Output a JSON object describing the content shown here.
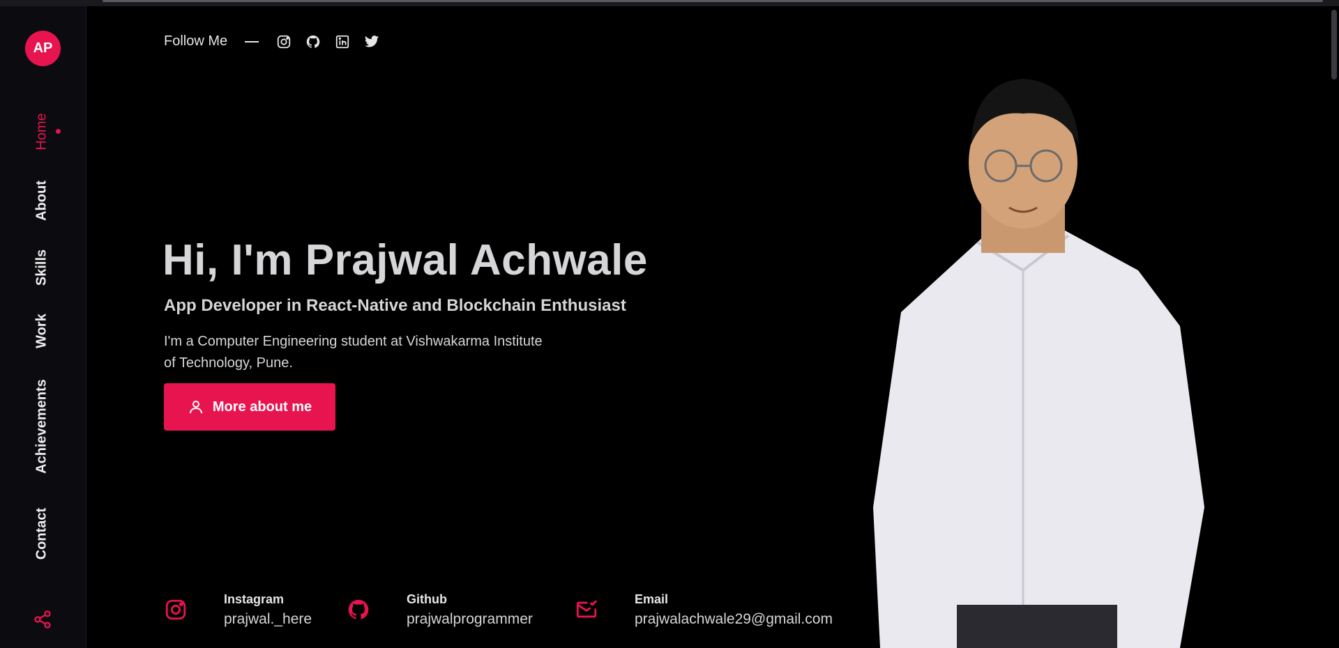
{
  "logo": {
    "initials": "AP"
  },
  "nav": {
    "items": [
      {
        "label": "Home",
        "active": true
      },
      {
        "label": "About"
      },
      {
        "label": "Skills"
      },
      {
        "label": "Work"
      },
      {
        "label": "Achievements"
      },
      {
        "label": "Contact"
      }
    ],
    "share_icon": "share-icon"
  },
  "follow": {
    "label": "Follow Me",
    "icons": [
      "instagram-icon",
      "github-icon",
      "linkedin-icon",
      "twitter-icon"
    ]
  },
  "hero": {
    "title": "Hi, I'm Prajwal Achwale",
    "subtitle": "App Developer in React-Native and Blockchain Enthusiast",
    "description": "I'm a Computer Engineering student at Vishwakarma Institute of Technology, Pune.",
    "button_label": "More about me"
  },
  "contacts": [
    {
      "icon": "instagram-icon",
      "label": "Instagram",
      "value": "prajwal._here"
    },
    {
      "icon": "github-icon",
      "label": "Github",
      "value": "prajwalprogrammer"
    },
    {
      "icon": "email-icon",
      "label": "Email",
      "value": "prajwalachwale29@gmail.com"
    }
  ],
  "colors": {
    "accent": "#e8144f",
    "background": "#000000",
    "sidebar": "#0c0c10",
    "text": "#d6d6d9"
  }
}
